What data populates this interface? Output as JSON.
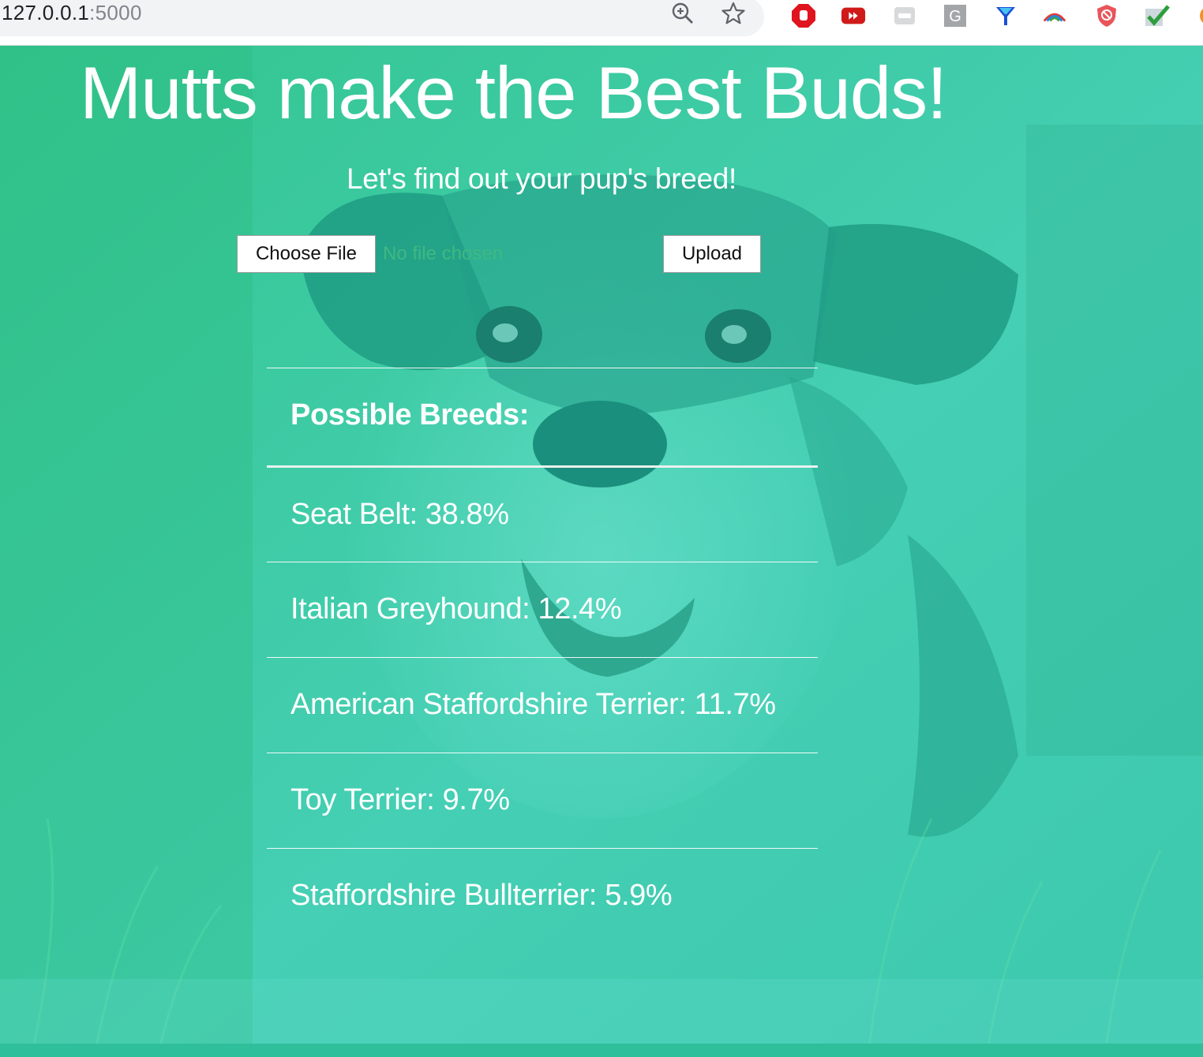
{
  "browser": {
    "url_host": "127.0.0.1",
    "url_port": ":5000",
    "icons": [
      "info-icon",
      "zoom-icon",
      "bookmark-star-icon"
    ],
    "extensions": [
      "adblock-icon",
      "video-ext-icon",
      "generic-ext-icon",
      "grammarly-icon",
      "funnel-ext-icon",
      "rainbow-ext-icon",
      "shield-ext-icon",
      "checkmark-ext-icon",
      "orange-ext-icon"
    ]
  },
  "page": {
    "title": "Mutts make the Best Buds!",
    "subtitle": "Let's find out your pup's breed!",
    "file_input": {
      "button_label": "Choose File",
      "status": "No file chosen"
    },
    "upload_label": "Upload",
    "results": {
      "header": "Possible Breeds:",
      "rows": [
        "Seat Belt: 38.8%",
        "Italian Greyhound: 12.4%",
        "American Staffordshire Terrier: 11.7%",
        "Toy Terrier: 9.7%",
        "Staffordshire Bullterrier: 5.9%"
      ]
    }
  },
  "colors": {
    "overlay_green": "#2fc594",
    "overlay_teal": "#4fd6c6",
    "text": "#ffffff"
  }
}
